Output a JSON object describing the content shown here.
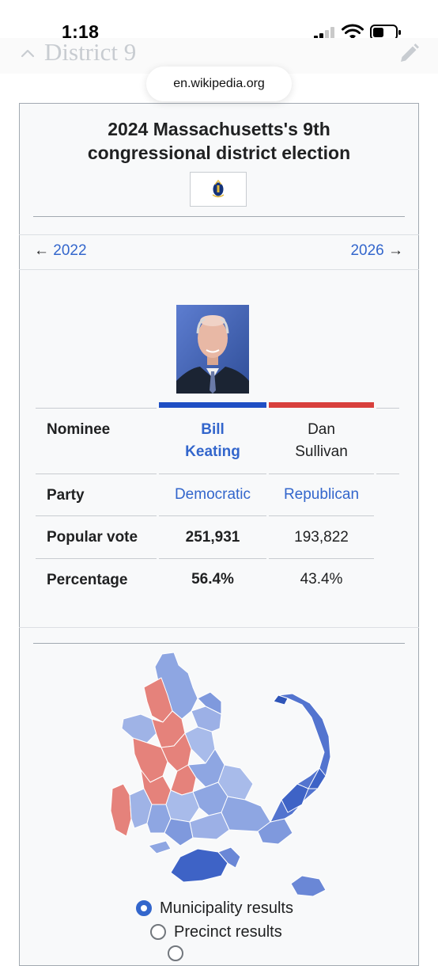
{
  "status_bar": {
    "time": "1:18"
  },
  "section": {
    "title": "District 9"
  },
  "browser": {
    "url": "en.wikipedia.org"
  },
  "infobox": {
    "title_line1": "2024 Massachusetts's 9th",
    "title_line2": "congressional district election",
    "nav": {
      "prev_arrow": "←",
      "prev": "2022",
      "next": "2026",
      "next_arrow": "→"
    },
    "table": {
      "rows": [
        {
          "label": "Nominee",
          "values": [
            {
              "line1": "Bill",
              "line2": "Keating"
            },
            {
              "line1": "Dan",
              "line2": "Sullivan"
            }
          ]
        },
        {
          "label": "Party",
          "values": [
            "Democratic",
            "Republican"
          ]
        },
        {
          "label": "Popular vote",
          "values": [
            "251,931",
            "193,822"
          ]
        },
        {
          "label": "Percentage",
          "values": [
            "56.4%",
            "43.4%"
          ]
        }
      ]
    },
    "party_colors": {
      "democratic": "#1f4fc4",
      "republican": "#d8403c"
    },
    "map_legend": {
      "options": [
        "Municipality results",
        "Precinct results"
      ],
      "selected": "Municipality results"
    }
  }
}
